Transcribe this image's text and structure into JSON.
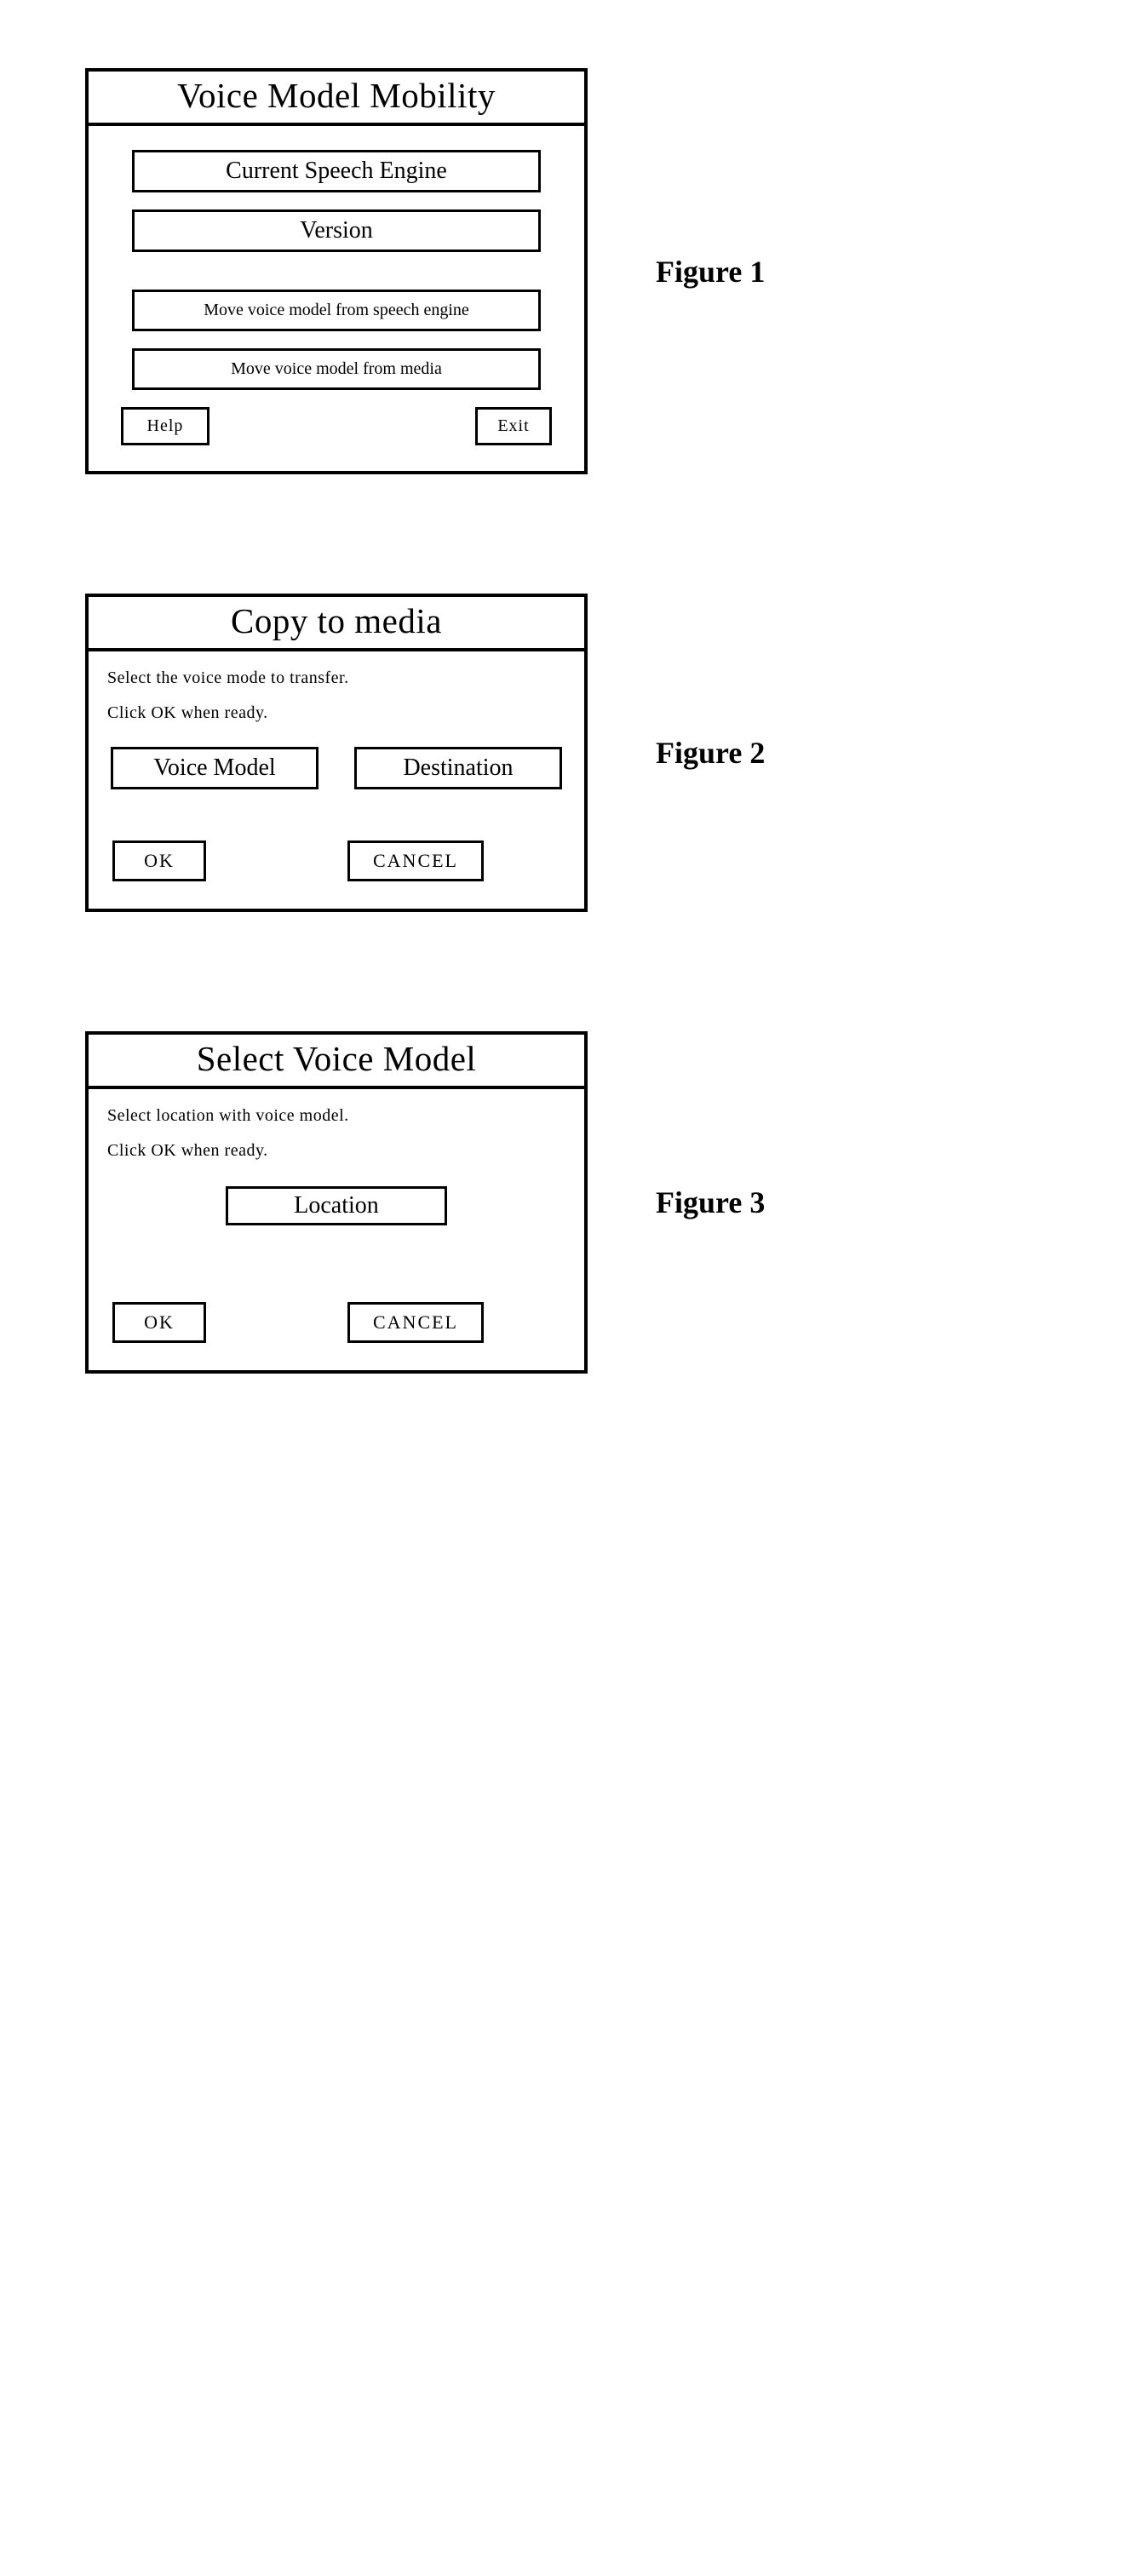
{
  "figures": {
    "f1": {
      "label": "Figure 1"
    },
    "f2": {
      "label": "Figure 2"
    },
    "f3": {
      "label": "Figure 3"
    }
  },
  "dialog1": {
    "title": "Voice Model Mobility",
    "btn_engine": "Current Speech Engine",
    "btn_version": "Version",
    "btn_move_engine": "Move voice model from speech engine",
    "btn_move_media": "Move voice model from media",
    "btn_help": "Help",
    "btn_exit": "Exit"
  },
  "dialog2": {
    "title": "Copy to media",
    "instr1": "Select the voice mode to transfer.",
    "instr2": "Click OK when ready.",
    "btn_voice_model": "Voice Model",
    "btn_destination": "Destination",
    "btn_ok": "OK",
    "btn_cancel": "CANCEL"
  },
  "dialog3": {
    "title": "Select Voice Model",
    "instr1": "Select location with voice model.",
    "instr2": "Click OK when ready.",
    "btn_location": "Location",
    "btn_ok": "OK",
    "btn_cancel": "CANCEL"
  }
}
